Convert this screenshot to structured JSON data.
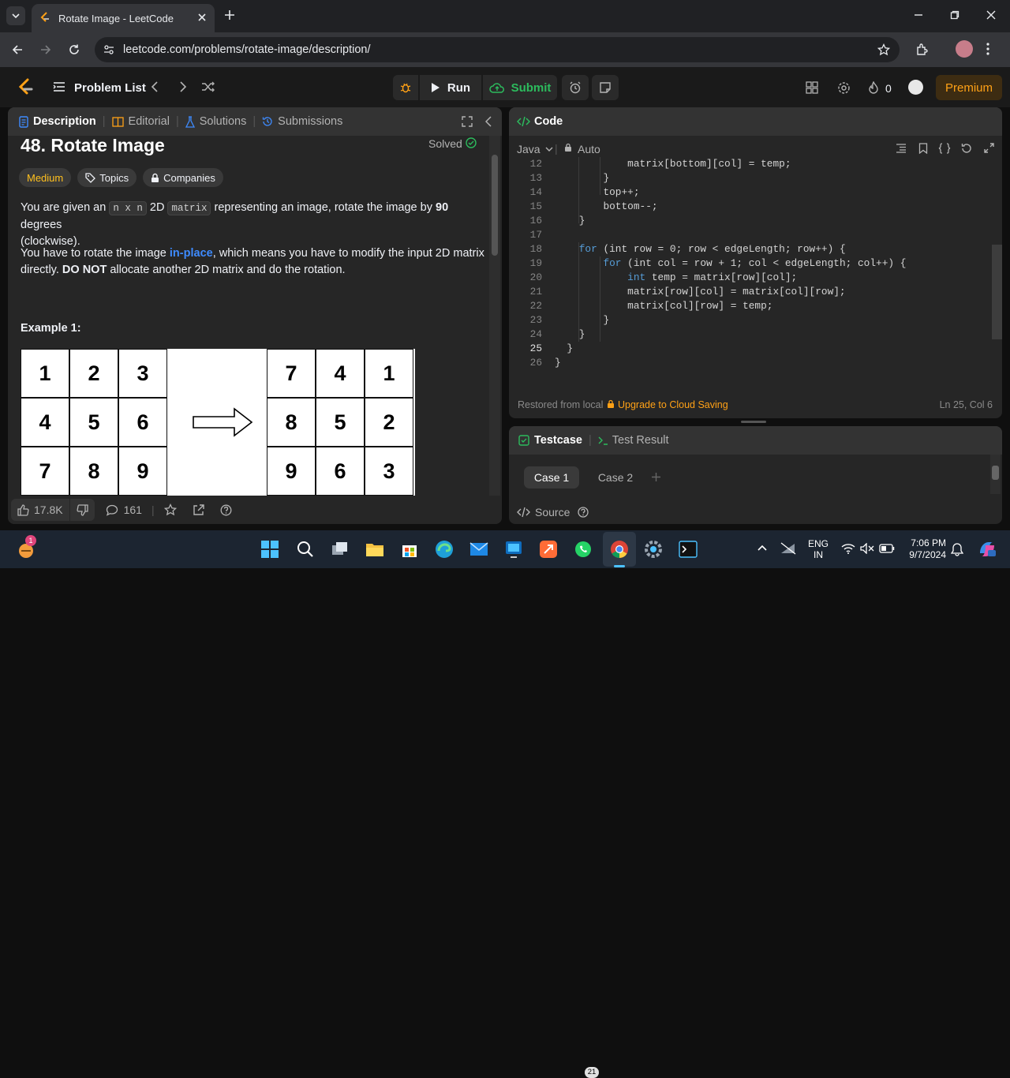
{
  "browser": {
    "tab_title": "Rotate Image - LeetCode",
    "url": "leetcode.com/problems/rotate-image/description/"
  },
  "nav": {
    "problem_list": "Problem List",
    "run": "Run",
    "submit": "Submit",
    "streak": "0",
    "premium": "Premium"
  },
  "description": {
    "tabs": [
      "Description",
      "Editorial",
      "Solutions",
      "Submissions"
    ],
    "title": "48. Rotate Image",
    "status": "Solved",
    "difficulty": "Medium",
    "topics": "Topics",
    "companies": "Companies",
    "para1": {
      "a": "You are given an ",
      "code1": "n x n",
      "b": " 2D ",
      "code2": "matrix",
      "c": " representing an image, rotate the image by ",
      "bold": "90",
      "d": " degrees",
      "e": "(clockwise)."
    },
    "para2": {
      "a": "You have to rotate the image ",
      "link": "in-place",
      "b": ", which means you have to modify the input 2D matrix",
      "c": "directly. ",
      "bold": "DO NOT",
      "d": " allocate another 2D matrix and do the rotation."
    },
    "example_title": "Example 1:",
    "matrix_in": [
      "1",
      "2",
      "3",
      "4",
      "5",
      "6",
      "7",
      "8",
      "9"
    ],
    "matrix_out": [
      "7",
      "4",
      "1",
      "8",
      "5",
      "2",
      "9",
      "6",
      "3"
    ],
    "likes": "17.8K",
    "comments": "161"
  },
  "code": {
    "header": "Code",
    "language": "Java",
    "auto": "Auto",
    "lines": [
      {
        "n": "12",
        "indent": "            ",
        "text": "matrix[bottom][col] = temp;"
      },
      {
        "n": "13",
        "indent": "        ",
        "text": "}"
      },
      {
        "n": "14",
        "indent": "        ",
        "text": "top++;"
      },
      {
        "n": "15",
        "indent": "        ",
        "text": "bottom--;"
      },
      {
        "n": "16",
        "indent": "    ",
        "text": "}"
      },
      {
        "n": "17",
        "indent": "",
        "text": ""
      },
      {
        "n": "18",
        "indent": "    ",
        "kw": "for",
        "text": " (int row = 0; row < edgeLength; row++) {"
      },
      {
        "n": "19",
        "indent": "        ",
        "kw": "for",
        "text": " (int col = row + 1; col < edgeLength; col++) {"
      },
      {
        "n": "20",
        "indent": "            ",
        "kw": "int",
        "text": " temp = matrix[row][col];"
      },
      {
        "n": "21",
        "indent": "            ",
        "text": "matrix[row][col] = matrix[col][row];"
      },
      {
        "n": "22",
        "indent": "            ",
        "text": "matrix[col][row] = temp;"
      },
      {
        "n": "23",
        "indent": "        ",
        "text": "}"
      },
      {
        "n": "24",
        "indent": "    ",
        "text": "}"
      },
      {
        "n": "25",
        "indent": "  ",
        "text": "}"
      },
      {
        "n": "26",
        "indent": "",
        "text": "}"
      }
    ],
    "restored": "Restored from local",
    "upgrade": "Upgrade to Cloud Saving",
    "cursor": "Ln 25, Col 6"
  },
  "testcase": {
    "tab1": "Testcase",
    "tab2": "Test Result",
    "case1": "Case 1",
    "case2": "Case 2",
    "source": "Source"
  },
  "taskbar": {
    "lang1": "ENG",
    "lang2": "IN",
    "time": "7:06 PM",
    "date": "9/7/2024",
    "whatsapp_badge": "21",
    "notif_badge": "1"
  }
}
